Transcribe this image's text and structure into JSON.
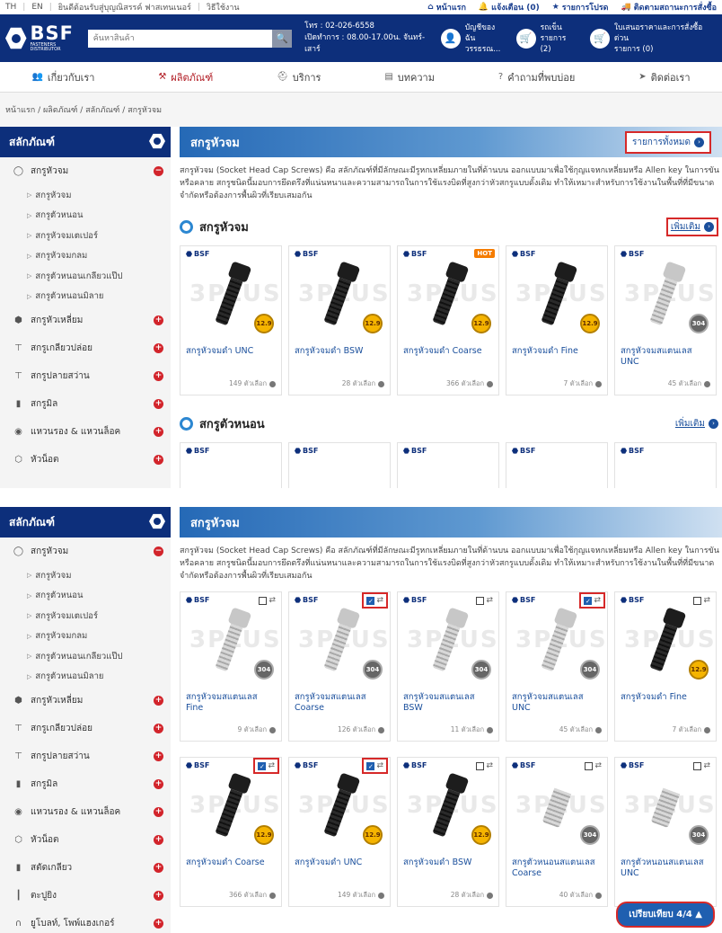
{
  "topbar": {
    "lang_th": "TH",
    "lang_en": "EN",
    "welcome": "ยินดีต้อนรับสู่บุญณิสรรค์ ฟาสเทนเนอร์",
    "howto": "วิธีใช้งาน",
    "home": "หน้าแรก",
    "notify": "แจ้งเตือน (0)",
    "favorites": "รายการโปรด",
    "track": "ติดตามสถานะการสั่งซื้อ"
  },
  "header": {
    "logo_text": "BSF",
    "logo_sub": "FASTENERS DISTRIBUTOR",
    "search_placeholder": "ค้นหาสินค้า",
    "phone": "โทร : 02-026-6558",
    "hours": "เปิดทำการ : 08.00-17.00น. จันทร์-เสาร์",
    "account_title": "บัญชีของฉัน",
    "account_sub": "วรรธรณ...",
    "cart_title": "รถเข็น",
    "cart_sub": "รายการ (2)",
    "quote_title": "ใบเสนอราคาและการสั่งซื้อด่วน",
    "quote_sub": "รายการ (0)"
  },
  "nav": [
    "เกี่ยวกับเรา",
    "ผลิตภัณฑ์",
    "บริการ",
    "บทความ",
    "คำถามที่พบบ่อย",
    "ติดต่อเรา"
  ],
  "breadcrumb": "หน้าแรก / ผลิตภัณฑ์ / สลักภัณฑ์ / สกรูหัวจม",
  "sidebar": {
    "title": "สลักภัณฑ์",
    "categories": [
      {
        "label": "สกรูหัวจม",
        "icon": "circle-icon",
        "expanded": true
      },
      {
        "label": "สกรูหัวเหลี่ยม",
        "icon": "hex-icon"
      },
      {
        "label": "สกรูเกลียวปล่อย",
        "icon": "screw-icon"
      },
      {
        "label": "สกรูปลายสว่าน",
        "icon": "drill-icon"
      },
      {
        "label": "สกรูมิล",
        "icon": "bolt-icon"
      },
      {
        "label": "แหวนรอง & แหวนล็อค",
        "icon": "washer-icon"
      },
      {
        "label": "หัวน็อต",
        "icon": "nut-icon"
      },
      {
        "label": "สตัดเกลียว",
        "icon": "stud-icon"
      },
      {
        "label": "ตะปูยิง",
        "icon": "nail-icon"
      },
      {
        "label": "ยูโบลท์, โพพ์แฮงเกอร์",
        "icon": "ubolt-icon"
      }
    ],
    "subitems": [
      "สกรูหัวจม",
      "สกรูตัวหนอน",
      "สกรูหัวจมเตเปอร์",
      "สกรูหัวจมกลม",
      "สกรูตัวหนอนเกลียวแป๊ป",
      "สกรูตัวหนอนมิลาย"
    ]
  },
  "main": {
    "banner_title": "สกรูหัวจม",
    "all_link": "รายการทั้งหมด",
    "description": "สกรูหัวจม (Socket Head Cap Screws) คือ สลักภัณฑ์ที่มีลักษณะมีรูหกเหลี่ยมภายในที่ด้านบน ออกแบบมาเพื่อใช้กุญแจหกเหลี่ยมหรือ Allen key ในการขันหรือคลาย สกรูชนิดนี้มอบการยึดตรึงที่แน่นหนาและความสามารถในการใช้แรงบิดที่สูงกว่าหัวสกรูแบบดั้งเดิม ทำให้เหมาะสำหรับการใช้งานในพื้นที่ที่มีขนาดจำกัดหรือต้องการพื้นผิวที่เรียบเสมอกัน",
    "section1_title": "สกรูหัวจม",
    "section2_title": "สกรูตัวหนอน",
    "more_link": "เพิ่มเติม",
    "brand": "BSF",
    "watermark": "3PLUS",
    "hot": "HOT",
    "products1": [
      {
        "name": "สกรูหัวจมดำ UNC",
        "count": "149 ตัวเลือก",
        "finish": "black",
        "grade": "12.9"
      },
      {
        "name": "สกรูหัวจมดำ BSW",
        "count": "28 ตัวเลือก",
        "finish": "black",
        "grade": "12.9"
      },
      {
        "name": "สกรูหัวจมดำ Coarse",
        "count": "366 ตัวเลือก",
        "finish": "black",
        "grade": "12.9",
        "hot": true
      },
      {
        "name": "สกรูหัวจมดำ Fine",
        "count": "7 ตัวเลือก",
        "finish": "black",
        "grade": "12.9"
      },
      {
        "name": "สกรูหัวจมสแตนเลส UNC",
        "count": "45 ตัวเลือก",
        "finish": "steel",
        "grade": "304"
      }
    ],
    "compare_button": "เปรียบเทียบ 4/4 ▲",
    "products2": [
      {
        "name": "สกรูหัวจมสแตนเลส Fine",
        "count": "9 ตัวเลือก",
        "finish": "steel",
        "grade": "304",
        "checked": false
      },
      {
        "name": "สกรูหัวจมสแตนเลส Coarse",
        "count": "126 ตัวเลือก",
        "finish": "steel",
        "grade": "304",
        "checked": true
      },
      {
        "name": "สกรูหัวจมสแตนเลส BSW",
        "count": "11 ตัวเลือก",
        "finish": "steel",
        "grade": "304",
        "checked": false
      },
      {
        "name": "สกรูหัวจมสแตนเลส UNC",
        "count": "45 ตัวเลือก",
        "finish": "steel",
        "grade": "304",
        "checked": true
      },
      {
        "name": "สกรูหัวจมดำ Fine",
        "count": "7 ตัวเลือก",
        "finish": "black",
        "grade": "12.9",
        "checked": false
      },
      {
        "name": "สกรูหัวจมดำ Coarse",
        "count": "366 ตัวเลือก",
        "finish": "black",
        "grade": "12.9",
        "checked": true
      },
      {
        "name": "สกรูหัวจมดำ UNC",
        "count": "149 ตัวเลือก",
        "finish": "black",
        "grade": "12.9",
        "checked": true
      },
      {
        "name": "สกรูหัวจมดำ BSW",
        "count": "28 ตัวเลือก",
        "finish": "black",
        "grade": "12.9",
        "checked": false
      },
      {
        "name": "สกรูตัวหนอนสแตนเลส Coarse",
        "count": "40 ตัวเลือก",
        "finish": "set",
        "grade": "304",
        "checked": false
      },
      {
        "name": "สกรูตัวหนอนสแตนเลส UNC",
        "count": "",
        "finish": "set",
        "grade": "304",
        "checked": false
      }
    ]
  }
}
